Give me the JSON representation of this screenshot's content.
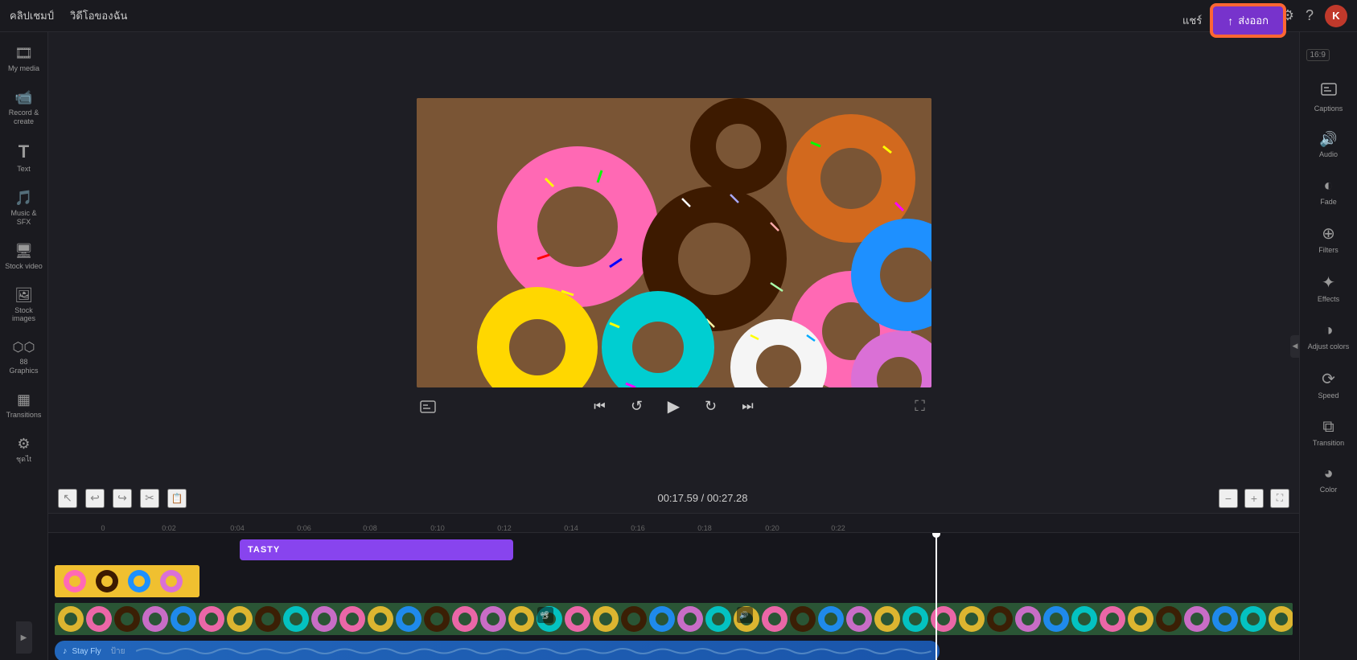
{
  "app": {
    "brand": "คลิปเชมป์",
    "nav_label": "วิดีโอของฉัน"
  },
  "topbar": {
    "share_label": "แชร์",
    "export_label": "ส่งออก",
    "aspect_ratio": "16:9"
  },
  "sidebar_left": {
    "items": [
      {
        "id": "my-media",
        "label": "My media",
        "icon": "🎞"
      },
      {
        "id": "record-create",
        "label": "Record &\ncreate",
        "icon": "📹"
      },
      {
        "id": "text",
        "label": "Text",
        "icon": "T"
      },
      {
        "id": "music-sfx",
        "label": "Music & SFX",
        "icon": "🎵"
      },
      {
        "id": "stock-video",
        "label": "Stock video",
        "icon": "🖥"
      },
      {
        "id": "stock-images",
        "label": "Stock images",
        "icon": "🖼"
      },
      {
        "id": "graphics",
        "label": "88 Graphics",
        "icon": "⬡"
      },
      {
        "id": "transitions",
        "label": "Transitions",
        "icon": "▦"
      },
      {
        "id": "tools",
        "label": "ชุดไt",
        "icon": "⚙"
      }
    ]
  },
  "sidebar_right": {
    "items": [
      {
        "id": "captions",
        "label": "Captions",
        "icon": "⊡"
      },
      {
        "id": "audio",
        "label": "Audio",
        "icon": "🔊"
      },
      {
        "id": "fade",
        "label": "Fade",
        "icon": "◐"
      },
      {
        "id": "filters",
        "label": "Filters",
        "icon": "⊕"
      },
      {
        "id": "effects",
        "label": "Effects",
        "icon": "✦"
      },
      {
        "id": "adjust-colors",
        "label": "Adjust colors",
        "icon": "◑"
      },
      {
        "id": "speed",
        "label": "Speed",
        "icon": "⟳"
      },
      {
        "id": "transition",
        "label": "Transition",
        "icon": "⧉"
      },
      {
        "id": "color",
        "label": "Color",
        "icon": "◕"
      }
    ]
  },
  "player": {
    "current_time": "00:17.59",
    "total_time": "00:27.28",
    "time_display": "00:17.59 / 00:27.28"
  },
  "timeline": {
    "markers": [
      "0",
      "0:02",
      "0:04",
      "0:06",
      "0:08",
      "0:10",
      "0:12",
      "0:14",
      "0:16",
      "0:18",
      "0:20",
      "0:22"
    ],
    "text_track_label": "TASTY",
    "audio_label": "Stay Fly",
    "audio_sub": "ป้าย"
  },
  "icons": {
    "expand_arrow": "▶",
    "collapse_arrow": "◀",
    "play": "▶",
    "prev_frame": "⏮",
    "next_frame": "⏭",
    "rewind": "↺",
    "forward": "↻",
    "scissors": "✂",
    "undo": "↩",
    "redo": "↪",
    "pointer": "↖",
    "zoom_in": "+",
    "zoom_out": "−",
    "fullscreen": "⛶",
    "captions_icon": "≡",
    "gear": "⚙",
    "flag": "⚑",
    "help": "?",
    "export_arrow": "↑"
  }
}
